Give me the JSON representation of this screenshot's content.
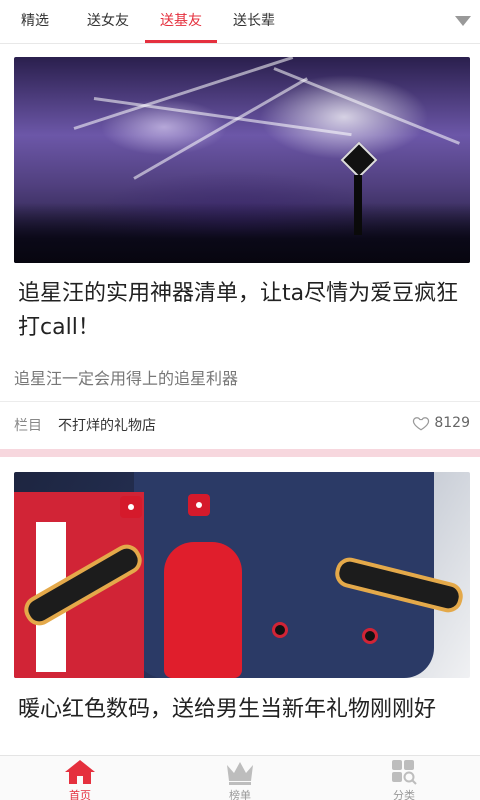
{
  "top_tabs": {
    "items": [
      {
        "label": "精选"
      },
      {
        "label": "送女友"
      },
      {
        "label": "送基友"
      },
      {
        "label": "送长辈"
      }
    ],
    "active_index": 2
  },
  "feed": {
    "cards": [
      {
        "image_alt": "concert crowd with stage lights",
        "title": "追星汪的实用神器清单，让ta尽情为爱豆疯狂打call！",
        "subtitle": "追星汪一定会用得上的追星利器",
        "meta_label": "栏目",
        "column_name": "不打烊的礼物店",
        "like_count": "8129"
      },
      {
        "image_alt": "red gadgets on a denim shirt",
        "title": "暖心红色数码，送给男生当新年礼物刚刚好"
      }
    ]
  },
  "bottom_nav": {
    "items": [
      {
        "label": "首页",
        "icon": "home-icon"
      },
      {
        "label": "榜单",
        "icon": "crown-icon"
      },
      {
        "label": "分类",
        "icon": "category-search-icon"
      }
    ],
    "active_index": 0
  },
  "colors": {
    "accent": "#e5303e",
    "separator": "#f7d7de"
  }
}
